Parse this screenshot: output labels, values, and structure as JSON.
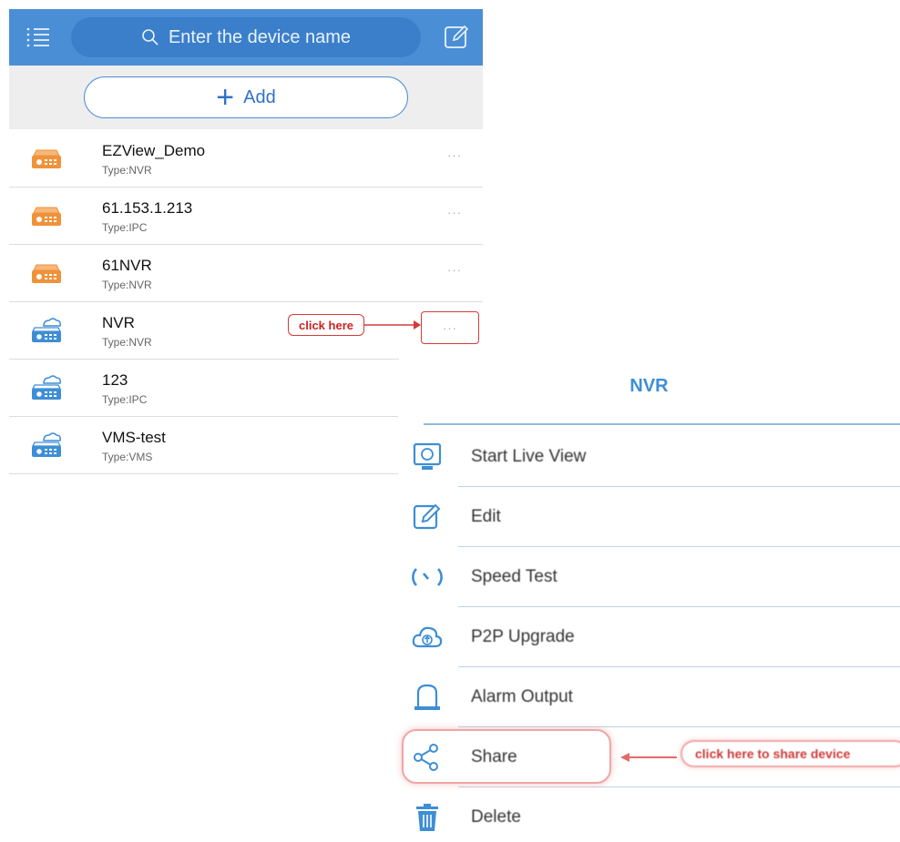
{
  "header": {
    "search_placeholder": "Enter the device name",
    "icons": {
      "menu": "list-menu-icon",
      "search": "search-icon",
      "edit": "edit-pencil-icon"
    }
  },
  "add_button": {
    "label": "Add",
    "icon": "plus-icon"
  },
  "devices": [
    {
      "name": "EZView_Demo",
      "type": "Type:NVR",
      "icon": "orange-dvr-icon",
      "more": "···"
    },
    {
      "name": "61.153.1.213",
      "type": "Type:IPC",
      "icon": "orange-dvr-icon",
      "more": "···"
    },
    {
      "name": "61NVR",
      "type": "Type:NVR",
      "icon": "orange-dvr-icon",
      "more": "···"
    },
    {
      "name": "NVR",
      "type": "Type:NVR",
      "icon": "cloud-dvr-icon",
      "more": "···"
    },
    {
      "name": "123",
      "type": "Type:IPC",
      "icon": "cloud-dvr-icon"
    },
    {
      "name": "VMS-test",
      "type": "Type:VMS",
      "icon": "cloud-dvr-icon"
    }
  ],
  "annotations": {
    "click_here": "click here",
    "share_note": "click here to share device"
  },
  "context_menu": {
    "title": "NVR",
    "items": [
      {
        "label": "Start Live View",
        "icon": "monitor-icon"
      },
      {
        "label": "Edit",
        "icon": "edit-icon"
      },
      {
        "label": "Speed Test",
        "icon": "speedometer-icon"
      },
      {
        "label": "P2P Upgrade",
        "icon": "cloud-upload-icon"
      },
      {
        "label": "Alarm Output",
        "icon": "alarm-bell-icon"
      },
      {
        "label": "Share",
        "icon": "share-icon"
      },
      {
        "label": "Delete",
        "icon": "trash-icon"
      }
    ]
  },
  "colors": {
    "header_blue": "#4a8fd6",
    "accent_blue": "#3d8ed6",
    "device_orange": "#f0923a",
    "annotation_red": "#d33b3b"
  }
}
